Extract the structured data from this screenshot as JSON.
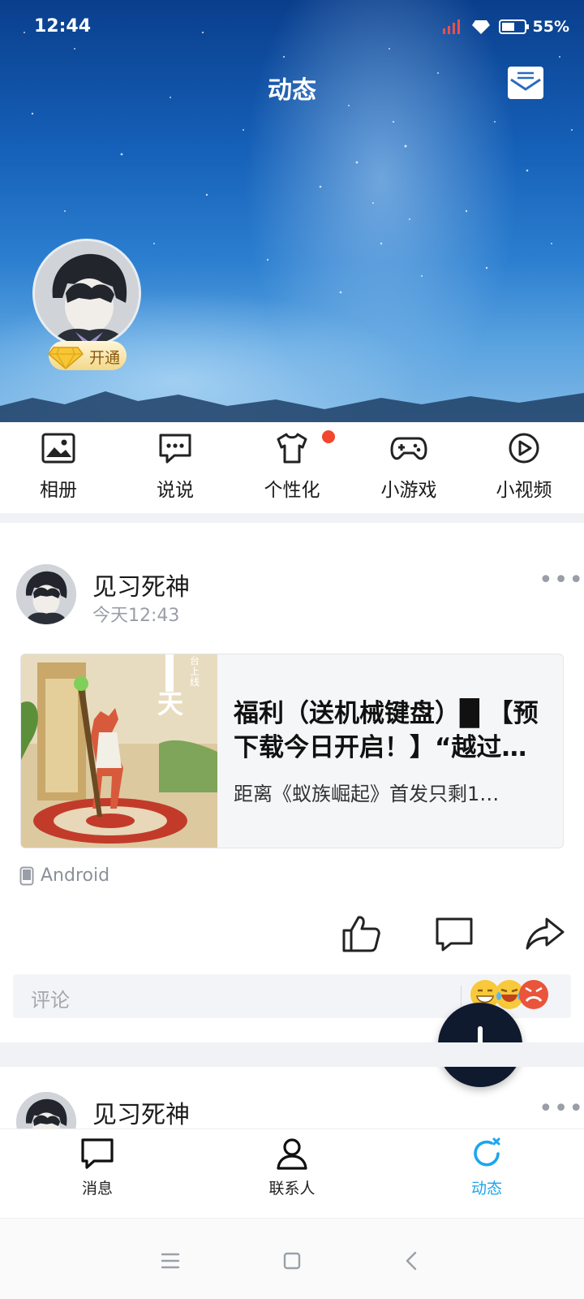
{
  "status_bar": {
    "time": "12:44",
    "battery": "55%"
  },
  "header": {
    "title": "动态"
  },
  "profile": {
    "vip_label": "开通"
  },
  "quick_actions": [
    {
      "label": "相册",
      "icon": "photo-album-icon"
    },
    {
      "label": "说说",
      "icon": "chat-bubble-dots-icon"
    },
    {
      "label": "个性化",
      "icon": "tshirt-icon",
      "has_notification": true
    },
    {
      "label": "小游戏",
      "icon": "gamepad-icon"
    },
    {
      "label": "小视频",
      "icon": "play-circle-icon"
    }
  ],
  "posts": [
    {
      "author": "见习死神",
      "time": "今天12:43",
      "card": {
        "title": "福利（送机械键盘）█ 【预下载今日开启！】“越过…",
        "description": "距离《蚁族崛起》首发只剩1…",
        "thumb_text": "天",
        "thumb_small": "台上线"
      },
      "device": "Android",
      "comment_placeholder": "评论"
    },
    {
      "author": "见习死神"
    }
  ],
  "bottom_nav": [
    {
      "label": "消息",
      "icon": "message-icon",
      "active": false
    },
    {
      "label": "联系人",
      "icon": "contacts-icon",
      "active": false
    },
    {
      "label": "动态",
      "icon": "feed-refresh-icon",
      "active": true
    }
  ],
  "colors": {
    "accent": "#1ba6ee",
    "fab": "#101a2e",
    "notification": "#f2462e"
  }
}
